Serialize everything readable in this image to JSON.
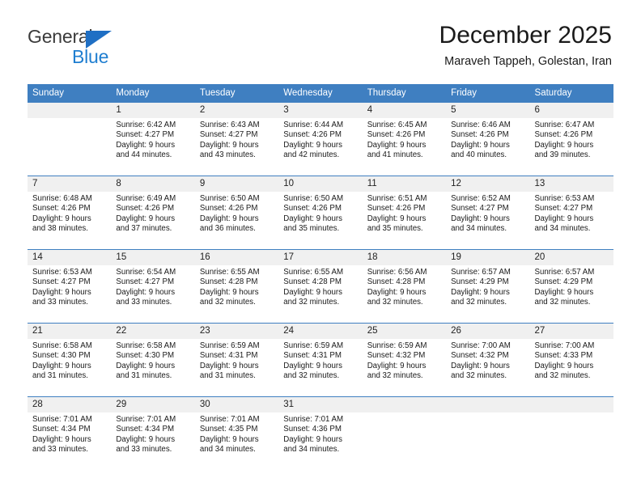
{
  "logo": {
    "word_top": "General",
    "word_bottom": "Blue",
    "triangle_color": "#1f6fc4",
    "blue_color": "#1f7ed0"
  },
  "header": {
    "title": "December 2025",
    "subtitle": "Maraveh Tappeh, Golestan, Iran"
  },
  "theme": {
    "header_row_bg": "#3f7fc1",
    "daynum_bg": "#f0f0f0",
    "row_rule": "#3f7fc1"
  },
  "columns": [
    "Sunday",
    "Monday",
    "Tuesday",
    "Wednesday",
    "Thursday",
    "Friday",
    "Saturday"
  ],
  "weeks": [
    [
      {
        "day": "",
        "lines": []
      },
      {
        "day": "1",
        "lines": [
          "Sunrise: 6:42 AM",
          "Sunset: 4:27 PM",
          "Daylight: 9 hours",
          "and 44 minutes."
        ]
      },
      {
        "day": "2",
        "lines": [
          "Sunrise: 6:43 AM",
          "Sunset: 4:27 PM",
          "Daylight: 9 hours",
          "and 43 minutes."
        ]
      },
      {
        "day": "3",
        "lines": [
          "Sunrise: 6:44 AM",
          "Sunset: 4:26 PM",
          "Daylight: 9 hours",
          "and 42 minutes."
        ]
      },
      {
        "day": "4",
        "lines": [
          "Sunrise: 6:45 AM",
          "Sunset: 4:26 PM",
          "Daylight: 9 hours",
          "and 41 minutes."
        ]
      },
      {
        "day": "5",
        "lines": [
          "Sunrise: 6:46 AM",
          "Sunset: 4:26 PM",
          "Daylight: 9 hours",
          "and 40 minutes."
        ]
      },
      {
        "day": "6",
        "lines": [
          "Sunrise: 6:47 AM",
          "Sunset: 4:26 PM",
          "Daylight: 9 hours",
          "and 39 minutes."
        ]
      }
    ],
    [
      {
        "day": "7",
        "lines": [
          "Sunrise: 6:48 AM",
          "Sunset: 4:26 PM",
          "Daylight: 9 hours",
          "and 38 minutes."
        ]
      },
      {
        "day": "8",
        "lines": [
          "Sunrise: 6:49 AM",
          "Sunset: 4:26 PM",
          "Daylight: 9 hours",
          "and 37 minutes."
        ]
      },
      {
        "day": "9",
        "lines": [
          "Sunrise: 6:50 AM",
          "Sunset: 4:26 PM",
          "Daylight: 9 hours",
          "and 36 minutes."
        ]
      },
      {
        "day": "10",
        "lines": [
          "Sunrise: 6:50 AM",
          "Sunset: 4:26 PM",
          "Daylight: 9 hours",
          "and 35 minutes."
        ]
      },
      {
        "day": "11",
        "lines": [
          "Sunrise: 6:51 AM",
          "Sunset: 4:26 PM",
          "Daylight: 9 hours",
          "and 35 minutes."
        ]
      },
      {
        "day": "12",
        "lines": [
          "Sunrise: 6:52 AM",
          "Sunset: 4:27 PM",
          "Daylight: 9 hours",
          "and 34 minutes."
        ]
      },
      {
        "day": "13",
        "lines": [
          "Sunrise: 6:53 AM",
          "Sunset: 4:27 PM",
          "Daylight: 9 hours",
          "and 34 minutes."
        ]
      }
    ],
    [
      {
        "day": "14",
        "lines": [
          "Sunrise: 6:53 AM",
          "Sunset: 4:27 PM",
          "Daylight: 9 hours",
          "and 33 minutes."
        ]
      },
      {
        "day": "15",
        "lines": [
          "Sunrise: 6:54 AM",
          "Sunset: 4:27 PM",
          "Daylight: 9 hours",
          "and 33 minutes."
        ]
      },
      {
        "day": "16",
        "lines": [
          "Sunrise: 6:55 AM",
          "Sunset: 4:28 PM",
          "Daylight: 9 hours",
          "and 32 minutes."
        ]
      },
      {
        "day": "17",
        "lines": [
          "Sunrise: 6:55 AM",
          "Sunset: 4:28 PM",
          "Daylight: 9 hours",
          "and 32 minutes."
        ]
      },
      {
        "day": "18",
        "lines": [
          "Sunrise: 6:56 AM",
          "Sunset: 4:28 PM",
          "Daylight: 9 hours",
          "and 32 minutes."
        ]
      },
      {
        "day": "19",
        "lines": [
          "Sunrise: 6:57 AM",
          "Sunset: 4:29 PM",
          "Daylight: 9 hours",
          "and 32 minutes."
        ]
      },
      {
        "day": "20",
        "lines": [
          "Sunrise: 6:57 AM",
          "Sunset: 4:29 PM",
          "Daylight: 9 hours",
          "and 32 minutes."
        ]
      }
    ],
    [
      {
        "day": "21",
        "lines": [
          "Sunrise: 6:58 AM",
          "Sunset: 4:30 PM",
          "Daylight: 9 hours",
          "and 31 minutes."
        ]
      },
      {
        "day": "22",
        "lines": [
          "Sunrise: 6:58 AM",
          "Sunset: 4:30 PM",
          "Daylight: 9 hours",
          "and 31 minutes."
        ]
      },
      {
        "day": "23",
        "lines": [
          "Sunrise: 6:59 AM",
          "Sunset: 4:31 PM",
          "Daylight: 9 hours",
          "and 31 minutes."
        ]
      },
      {
        "day": "24",
        "lines": [
          "Sunrise: 6:59 AM",
          "Sunset: 4:31 PM",
          "Daylight: 9 hours",
          "and 32 minutes."
        ]
      },
      {
        "day": "25",
        "lines": [
          "Sunrise: 6:59 AM",
          "Sunset: 4:32 PM",
          "Daylight: 9 hours",
          "and 32 minutes."
        ]
      },
      {
        "day": "26",
        "lines": [
          "Sunrise: 7:00 AM",
          "Sunset: 4:32 PM",
          "Daylight: 9 hours",
          "and 32 minutes."
        ]
      },
      {
        "day": "27",
        "lines": [
          "Sunrise: 7:00 AM",
          "Sunset: 4:33 PM",
          "Daylight: 9 hours",
          "and 32 minutes."
        ]
      }
    ],
    [
      {
        "day": "28",
        "lines": [
          "Sunrise: 7:01 AM",
          "Sunset: 4:34 PM",
          "Daylight: 9 hours",
          "and 33 minutes."
        ]
      },
      {
        "day": "29",
        "lines": [
          "Sunrise: 7:01 AM",
          "Sunset: 4:34 PM",
          "Daylight: 9 hours",
          "and 33 minutes."
        ]
      },
      {
        "day": "30",
        "lines": [
          "Sunrise: 7:01 AM",
          "Sunset: 4:35 PM",
          "Daylight: 9 hours",
          "and 34 minutes."
        ]
      },
      {
        "day": "31",
        "lines": [
          "Sunrise: 7:01 AM",
          "Sunset: 4:36 PM",
          "Daylight: 9 hours",
          "and 34 minutes."
        ]
      },
      {
        "day": "",
        "lines": []
      },
      {
        "day": "",
        "lines": []
      },
      {
        "day": "",
        "lines": []
      }
    ]
  ]
}
